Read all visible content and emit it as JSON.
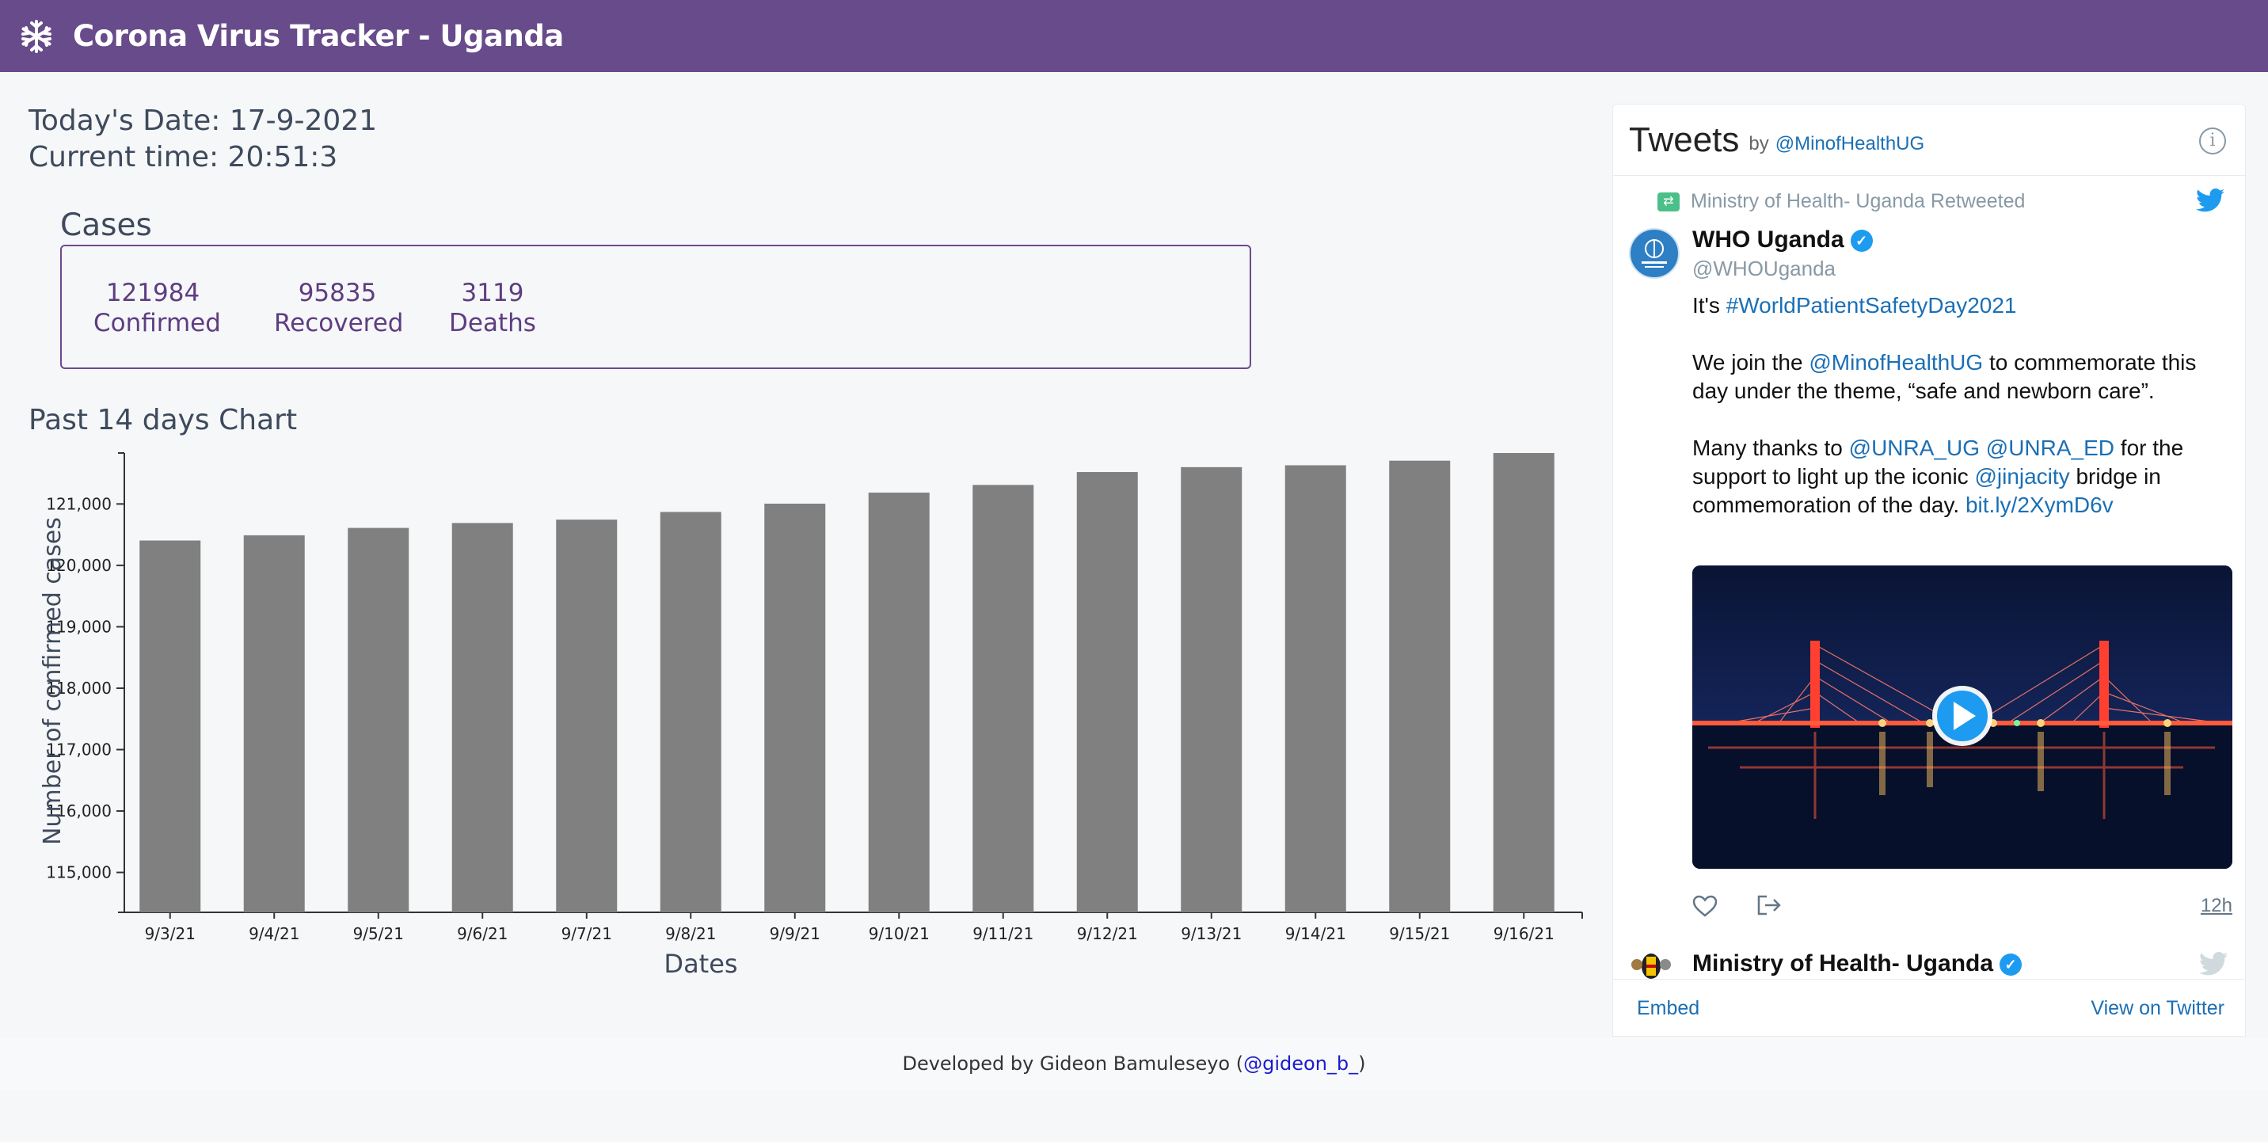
{
  "app": {
    "title": "Corona Virus Tracker - Uganda"
  },
  "header": {
    "date_text": "Today's Date: 17-9-2021",
    "time_text": "Current time: 20:51:3"
  },
  "cases": {
    "title": "Cases",
    "stats": [
      {
        "value": "121984",
        "label": "Confirmed"
      },
      {
        "value": "95835",
        "label": "Recovered"
      },
      {
        "value": "3119",
        "label": "Deaths"
      }
    ]
  },
  "chart": {
    "title": "Past 14 days Chart"
  },
  "chart_data": {
    "type": "bar",
    "title": "Past 14 days Chart",
    "xlabel": "Dates",
    "ylabel": "Number of confirmed cases",
    "categories": [
      "9/3/21",
      "9/4/21",
      "9/5/21",
      "9/6/21",
      "9/7/21",
      "9/8/21",
      "9/9/21",
      "9/10/21",
      "9/11/21",
      "9/12/21",
      "9/13/21",
      "9/14/21",
      "9/15/21",
      "9/16/21"
    ],
    "values": [
      120405,
      120490,
      120610,
      120690,
      120745,
      120870,
      121005,
      121185,
      121310,
      121520,
      121600,
      121630,
      121705,
      121830
    ],
    "ylim": [
      114350,
      121830
    ],
    "yticks": [
      115000,
      116000,
      117000,
      118000,
      119000,
      120000,
      121000
    ],
    "ytick_labels": [
      "115,000",
      "116,000",
      "117,000",
      "118,000",
      "119,000",
      "120,000",
      "121,000"
    ],
    "bar_color": "#808080",
    "grid": false
  },
  "twitter": {
    "title": "Tweets",
    "by": "by",
    "handle": "@MinofHealthUG",
    "retweet_text": "Ministry of Health- Uganda Retweeted",
    "author_name": "WHO Uganda",
    "author_handle": "@WHOUganda",
    "text_lines": [
      [
        "It's ",
        {
          "link": "#WorldPatientSafetyDay2021"
        }
      ],
      [],
      [
        "We join the ",
        {
          "link": "@MinofHealthUG"
        },
        " to commemorate this"
      ],
      [
        "day under the theme, “safe and newborn care”."
      ],
      [],
      [
        "Many thanks to ",
        {
          "link": "@UNRA_UG"
        },
        " ",
        {
          "link": "@UNRA_ED"
        },
        " for the"
      ],
      [
        "support to light up the iconic ",
        {
          "link": "@jinjacity"
        },
        " bridge in"
      ],
      [
        "commemoration of the day. ",
        {
          "link": "bit.ly/2XymD6v"
        }
      ]
    ],
    "time": "12h",
    "next_author": "Ministry of Health- Uganda",
    "embed": "Embed",
    "view_on_twitter": "View on Twitter",
    "colors": {
      "link": "#1b6fb5",
      "verified": "#1d9bf0"
    }
  },
  "footer": {
    "text": "Developed by Gideon Bamuleseyo (",
    "link": "@gideon_b_",
    "close": ")"
  },
  "colors": {
    "navbar": "#674b8a",
    "accent": "#5e3d80"
  }
}
